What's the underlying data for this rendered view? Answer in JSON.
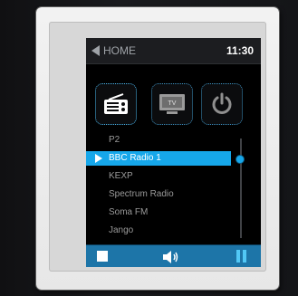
{
  "header": {
    "back_label": "HOME",
    "clock": "11:30"
  },
  "source_buttons": [
    {
      "name": "radio",
      "icon": "radio-icon"
    },
    {
      "name": "tv",
      "icon": "tv-icon",
      "label": "TV"
    },
    {
      "name": "power",
      "icon": "power-icon"
    }
  ],
  "stations": [
    {
      "label": "P2",
      "selected": false
    },
    {
      "label": "BBC Radio 1",
      "selected": true
    },
    {
      "label": "KEXP",
      "selected": false
    },
    {
      "label": "Spectrum Radio",
      "selected": false
    },
    {
      "label": "Soma FM",
      "selected": false
    },
    {
      "label": "Jango",
      "selected": false
    }
  ],
  "playback": {
    "stop": "stop-icon",
    "volume": "volume-icon",
    "pause": "pause-icon"
  },
  "colors": {
    "accent": "#16a7ea",
    "bottom_bar": "#1d75a8",
    "screen_bg": "#000000"
  }
}
